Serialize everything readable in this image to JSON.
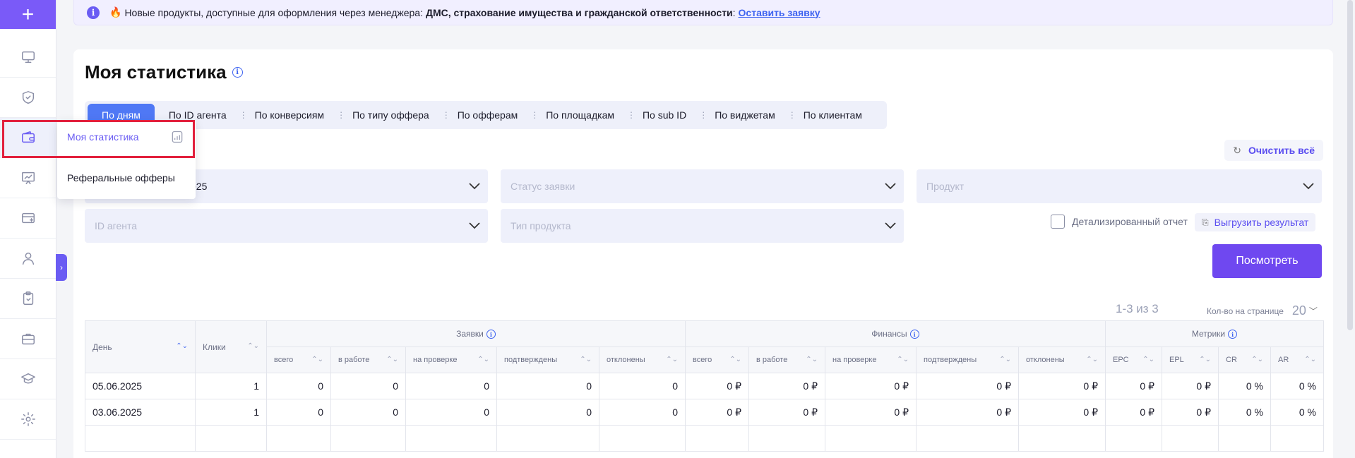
{
  "sidebar": {
    "add_label": "+",
    "items": [
      {
        "icon": "monitor-icon"
      },
      {
        "icon": "shield-check-icon"
      },
      {
        "icon": "wallet-icon"
      },
      {
        "icon": "chart-board-icon"
      },
      {
        "icon": "card-plus-icon"
      },
      {
        "icon": "user-icon"
      },
      {
        "icon": "clipboard-icon"
      },
      {
        "icon": "briefcase-icon"
      },
      {
        "icon": "graduation-cap-icon"
      },
      {
        "icon": "gear-icon"
      }
    ],
    "toggle_label": "›"
  },
  "flyout": {
    "items": [
      "Моя статистика",
      "Реферальные офферы"
    ]
  },
  "banner": {
    "icon_label": "i",
    "fire": "🔥",
    "text": "Новые продукты, доступные для оформления через менеджера:",
    "bold": "ДМС, страхование имущества и гражданской ответственности",
    "colon": ":",
    "link": "Оставить заявку"
  },
  "page": {
    "title": "Моя статистика",
    "info_label": "i"
  },
  "tabs": [
    "По дням",
    "По ID агента",
    "По конверсиям",
    "По типу оффера",
    "По офферам",
    "По площадкам",
    "По sub ID",
    "По виджетам",
    "По клиентам"
  ],
  "clear_button": {
    "icon": "↻",
    "label": "Очистить всё"
  },
  "filters": {
    "date_value": "025",
    "status_placeholder": "Статус заявки",
    "product_placeholder": "Продукт",
    "agent_placeholder": "ID агента",
    "product_type_placeholder": "Тип продукта"
  },
  "detail_label": "Детализированный отчет",
  "export_button": {
    "icon": "⎘",
    "label": "Выгрузить результат"
  },
  "view_button": "Посмотреть",
  "pager": {
    "range": "1-3 из 3",
    "per_page_label": "Кол-во на странице",
    "per_page_value": "20",
    "chev": "﹀"
  },
  "table": {
    "headers": {
      "day": "День",
      "clicks": "Клики",
      "group_applications": "Заявки",
      "group_finance": "Финансы",
      "group_metrics": "Метрики",
      "sub": [
        "всего",
        "в работе",
        "на проверке",
        "подтверждены",
        "отклонены",
        "всего",
        "в работе",
        "на проверке",
        "подтверждены",
        "отклонены",
        "EPC",
        "EPL",
        "CR",
        "AR"
      ]
    },
    "sort_icon": "⌃⌄",
    "rows": [
      {
        "day": "05.06.2025",
        "clicks": "1",
        "cells": [
          "0",
          "0",
          "0",
          "0",
          "0",
          "0 ₽",
          "0 ₽",
          "0 ₽",
          "0 ₽",
          "0 ₽",
          "0 ₽",
          "0 ₽",
          "0 %",
          "0 %"
        ]
      },
      {
        "day": "03.06.2025",
        "clicks": "1",
        "cells": [
          "0",
          "0",
          "0",
          "0",
          "0",
          "0 ₽",
          "0 ₽",
          "0 ₽",
          "0 ₽",
          "0 ₽",
          "0 ₽",
          "0 ₽",
          "0 %",
          "0 %"
        ]
      },
      {
        "day": "",
        "clicks": "",
        "cells": [
          "",
          "",
          "",
          "",
          "",
          "",
          "",
          "",
          "",
          "",
          "",
          "",
          "",
          ""
        ]
      }
    ]
  }
}
